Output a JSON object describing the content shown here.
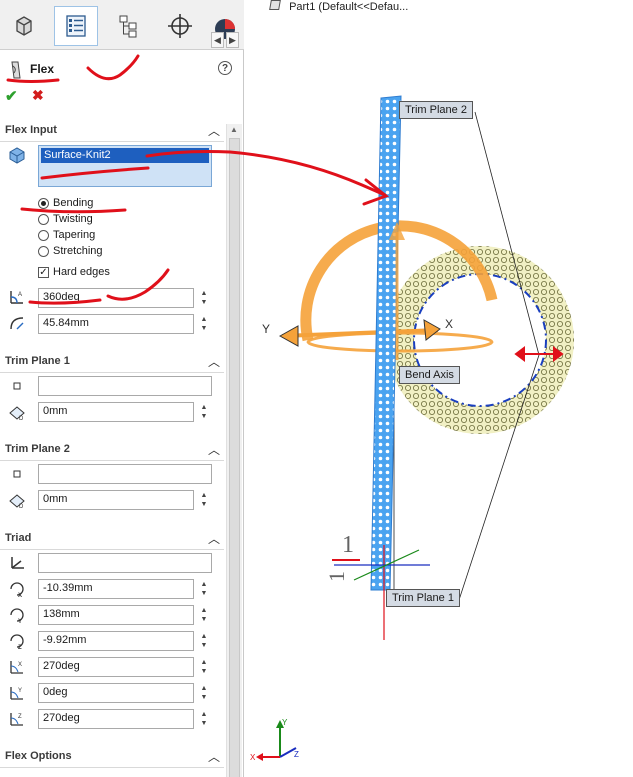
{
  "tabs": {
    "items": [
      {
        "name": "feature-manager",
        "icon": "feature-tree-icon"
      },
      {
        "name": "property-manager",
        "icon": "property-manager-icon",
        "active": true
      },
      {
        "name": "configuration-manager",
        "icon": "configuration-icon"
      },
      {
        "name": "dimxpert-manager",
        "icon": "crosshair-icon"
      },
      {
        "name": "display-manager",
        "icon": "display-manager-icon"
      }
    ]
  },
  "feature": {
    "title": "Flex",
    "help": "?",
    "ok": "✔",
    "cancel": "✖"
  },
  "flex_input": {
    "title": "Flex Input",
    "selected_body": "Surface-Knit2",
    "modes": [
      "Bending",
      "Twisting",
      "Tapering",
      "Stretching"
    ],
    "selected_mode": "Bending",
    "hard_edges_label": "Hard edges",
    "hard_edges_checked": true,
    "angle": "360deg",
    "radius": "45.84mm"
  },
  "trim_plane_1": {
    "title": "Trim Plane 1",
    "reference": "",
    "distance": "0mm"
  },
  "trim_plane_2": {
    "title": "Trim Plane 2",
    "reference": "",
    "distance": "0mm"
  },
  "triad": {
    "title": "Triad",
    "reference": "",
    "x": "-10.39mm",
    "y": "138mm",
    "z": "-9.92mm",
    "rot_x": "270deg",
    "rot_y": "0deg",
    "rot_z": "270deg"
  },
  "flex_options": {
    "title": "Flex Options"
  },
  "viewport": {
    "tree_root": "Part1  (Default<<Defau...",
    "callout_trim2": "Trim Plane 2",
    "callout_trim1": "Trim Plane 1",
    "callout_bend_axis": "Bend Axis",
    "axis_x": "X",
    "axis_y": "Y",
    "colors": {
      "mesh": "#4aa3f0",
      "torus": "#e8e6a8",
      "bend_arc": "#f5a23a",
      "annotation": "#e0101a"
    }
  }
}
